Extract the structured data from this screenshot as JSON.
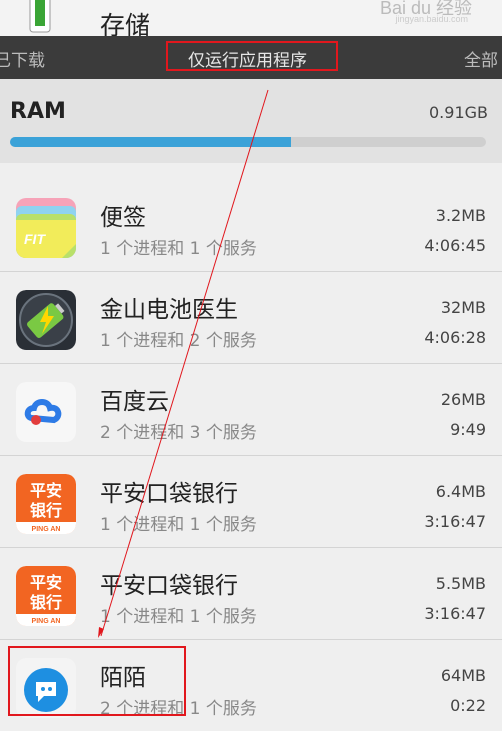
{
  "header": {
    "storage_title": "存储",
    "watermark": "Bai du 经验",
    "watermark_url": "jingyan.baidu.com"
  },
  "tabs": [
    {
      "label": "已下载"
    },
    {
      "label": "仅运行应用程序"
    },
    {
      "label": "全部"
    }
  ],
  "ram": {
    "label": "RAM",
    "value": "0.91GB",
    "used_fraction": 0.59
  },
  "apps": [
    {
      "name": "便签",
      "processes": "1 个进程和 1 个服务",
      "size": "3.2MB",
      "time": "4:06:45",
      "icon": "note-icon"
    },
    {
      "name": "金山电池医生",
      "processes": "1 个进程和 2 个服务",
      "size": "32MB",
      "time": "4:06:28",
      "icon": "battery-icon"
    },
    {
      "name": "百度云",
      "processes": "2 个进程和 3 个服务",
      "size": "26MB",
      "time": "9:49",
      "icon": "baidu-cloud-icon"
    },
    {
      "name": "平安口袋银行",
      "processes": "1 个进程和 1 个服务",
      "size": "6.4MB",
      "time": "3:16:47",
      "icon": "pingan-icon",
      "icon_text": [
        "平安",
        "银行",
        "PING AN"
      ]
    },
    {
      "name": "平安口袋银行",
      "processes": "1 个进程和 1 个服务",
      "size": "5.5MB",
      "time": "3:16:47",
      "icon": "pingan-icon",
      "icon_text": [
        "平安",
        "银行",
        "PING AN"
      ]
    },
    {
      "name": "陌陌",
      "processes": "2 个进程和 1 个服务",
      "size": "64MB",
      "time": "0:22",
      "icon": "momo-icon"
    }
  ],
  "note_icon_text": "FIT",
  "colors": {
    "accent": "#3ba2d8",
    "highlight": "#e1171d",
    "pingan": "#f26522",
    "momo": "#1e8fe1"
  }
}
